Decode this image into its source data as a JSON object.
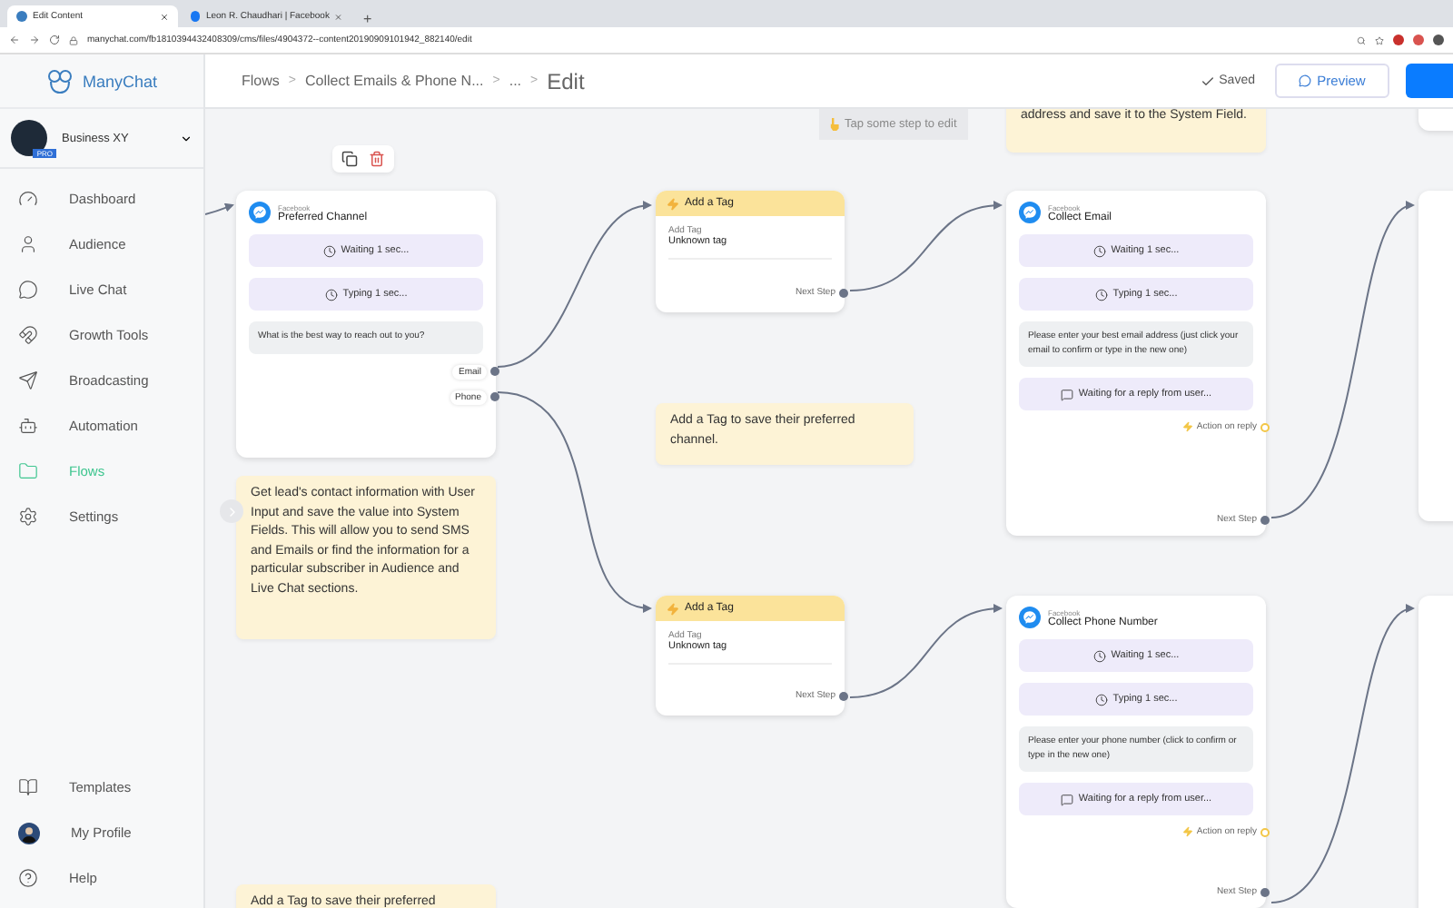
{
  "browser": {
    "tabs": [
      {
        "title": "Edit Content",
        "selected": true
      },
      {
        "title": "Leon R. Chaudhari | Facebook",
        "selected": false
      }
    ],
    "new_tab": "+",
    "url": "manychat.com/fb1810394432408309/cms/files/4904372--content20190909101942_882140/edit"
  },
  "sidebar": {
    "logo": "ManyChat",
    "account": {
      "name": "Business XY",
      "badge": "PRO"
    },
    "items": [
      {
        "label": "Dashboard",
        "kind": "dashboard",
        "selected": false
      },
      {
        "label": "Audience",
        "kind": "audience",
        "selected": false
      },
      {
        "label": "Live Chat",
        "kind": "chat",
        "selected": false
      },
      {
        "label": "Growth Tools",
        "kind": "growth",
        "selected": false
      },
      {
        "label": "Broadcasting",
        "kind": "broadcast",
        "selected": false
      },
      {
        "label": "Automation",
        "kind": "automation",
        "selected": false
      },
      {
        "label": "Flows",
        "kind": "flows",
        "selected": true
      },
      {
        "label": "Settings",
        "kind": "settings",
        "selected": false
      }
    ],
    "bottom_items": [
      {
        "label": "Templates",
        "kind": "templates"
      },
      {
        "label": "My Profile",
        "kind": "profile"
      },
      {
        "label": "Help",
        "kind": "help"
      }
    ]
  },
  "header": {
    "breadcrumbs": [
      "Flows",
      "Collect Emails & Phone N...",
      "...",
      "Edit"
    ],
    "separator": ">",
    "saved": "Saved",
    "preview": "Preview"
  },
  "canvas": {
    "hint": "Tap some step to edit",
    "nodes": [
      {
        "kind": "message",
        "channel": "Facebook",
        "title": "Preferred Channel",
        "steps": [
          {
            "kind": "delay",
            "text": "Waiting 1 sec..."
          },
          {
            "kind": "delay",
            "text": "Typing 1 sec..."
          },
          {
            "kind": "text",
            "text": "What is the best way to reach out to you?"
          }
        ],
        "buttons": [
          "Email",
          "Phone"
        ]
      },
      {
        "kind": "note",
        "text": "Get lead's contact information with User Input and save the value into System Fields. This will allow you to send SMS and Emails or find the information for a particular subscriber in Audience and Live Chat sections."
      },
      {
        "kind": "note",
        "text": "address and save it to the System Field."
      },
      {
        "kind": "action",
        "title": "Add a Tag",
        "label": "Add Tag",
        "value": "Unknown tag",
        "next": "Next Step"
      },
      {
        "kind": "note",
        "text": "Add a Tag to save their preferred channel."
      },
      {
        "kind": "message",
        "channel": "Facebook",
        "title": "Collect Email",
        "steps": [
          {
            "kind": "delay",
            "text": "Waiting 1 sec..."
          },
          {
            "kind": "delay",
            "text": "Typing 1 sec..."
          },
          {
            "kind": "text",
            "text": "Please enter your best email address (just click your email to confirm or type in the new one)"
          },
          {
            "kind": "reply",
            "text": "Waiting for a reply from user..."
          }
        ],
        "action": "Action on reply",
        "next": "Next Step"
      },
      {
        "kind": "action",
        "title": "Add a Tag",
        "label": "Add Tag",
        "value": "Unknown tag",
        "next": "Next Step"
      },
      {
        "kind": "message",
        "channel": "Facebook",
        "title": "Collect Phone Number",
        "steps": [
          {
            "kind": "delay",
            "text": "Waiting 1 sec..."
          },
          {
            "kind": "delay",
            "text": "Typing 1 sec..."
          },
          {
            "kind": "text",
            "text": "Please enter your phone number (click to confirm or type in the new one)"
          },
          {
            "kind": "reply",
            "text": "Waiting for a reply from user..."
          }
        ],
        "action": "Action on reply",
        "next": "Next Step"
      },
      {
        "kind": "note",
        "text": "Add a Tag to save their preferred"
      }
    ]
  }
}
